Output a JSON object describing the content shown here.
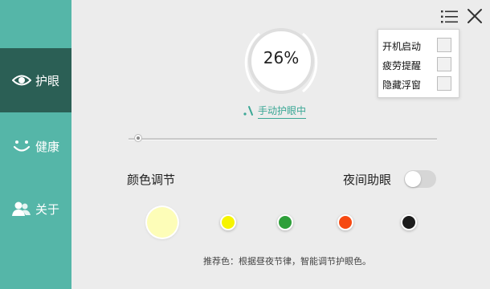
{
  "sidebar": {
    "items": [
      {
        "label": "护眼",
        "icon": "eye-icon",
        "active": true
      },
      {
        "label": "健康",
        "icon": "smile-icon",
        "active": false
      },
      {
        "label": "关于",
        "icon": "users-icon",
        "active": false
      }
    ]
  },
  "header": {
    "menu_icon": "list-menu-icon",
    "close_icon": "close-icon"
  },
  "eye_protection": {
    "percent_text": "26%",
    "level": 0.26,
    "mode_text": "手动护眼中"
  },
  "slider": {
    "value": 0.02
  },
  "color": {
    "label": "颜色调节",
    "swatches": [
      "#fdfdb8",
      "#f6f400",
      "#2e9f3a",
      "#f64a13",
      "#1c1c1c"
    ],
    "selected_index": 0
  },
  "night_mode": {
    "label": "夜间助眼",
    "enabled": false
  },
  "hint": "推荐色：根据昼夜节律，智能调节护眼色。",
  "menu": {
    "items": [
      {
        "label": "开机启动",
        "checked": false
      },
      {
        "label": "疲劳提醒",
        "checked": false
      },
      {
        "label": "隐藏浮窗",
        "checked": false
      }
    ]
  },
  "colors": {
    "sidebar_bg": "#55b6a8",
    "sidebar_active": "#2b5f55",
    "accent": "#3aa795",
    "main_bg": "#ececec"
  }
}
